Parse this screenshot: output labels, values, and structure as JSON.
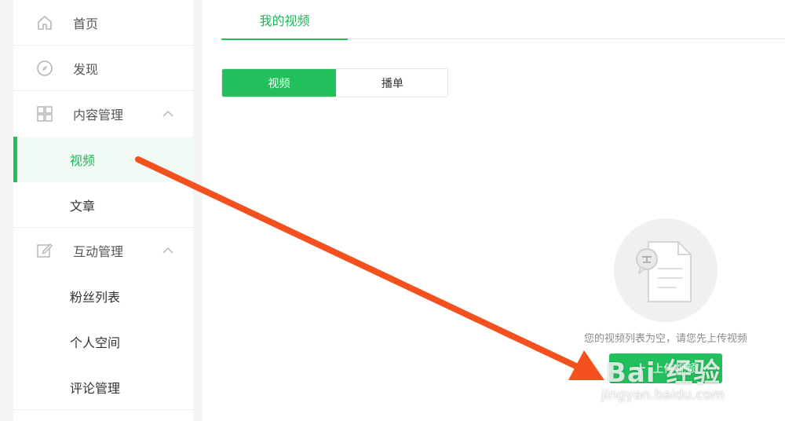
{
  "sidebar": {
    "items": [
      {
        "label": "首页",
        "icon": "home-icon"
      },
      {
        "label": "发现",
        "icon": "compass-icon"
      },
      {
        "label": "内容管理",
        "icon": "grid-icon",
        "expanded": true,
        "children": [
          {
            "label": "视频",
            "active": true
          },
          {
            "label": "文章"
          }
        ]
      },
      {
        "label": "互动管理",
        "icon": "edit-icon",
        "expanded": true,
        "children": [
          {
            "label": "粉丝列表"
          },
          {
            "label": "个人空间"
          },
          {
            "label": "评论管理"
          }
        ]
      }
    ]
  },
  "main": {
    "tabs": [
      {
        "label": "我的视频",
        "active": true
      }
    ],
    "segment": [
      {
        "label": "视频",
        "active": true
      },
      {
        "label": "播单",
        "active": false
      }
    ],
    "empty": {
      "icon": "empty-document-icon",
      "text": "您的视频列表为空，请您先上传视频",
      "upload_label": "上传视频"
    }
  },
  "watermark": {
    "logo": "Bai 经验",
    "url": "jingyan.baidu.com"
  },
  "colors": {
    "accent": "#22c05d",
    "accent_text": "#22b45a",
    "active_bg": "#f1faf4",
    "arrow": "#f4511e",
    "page_bg": "#f5f5f5"
  }
}
